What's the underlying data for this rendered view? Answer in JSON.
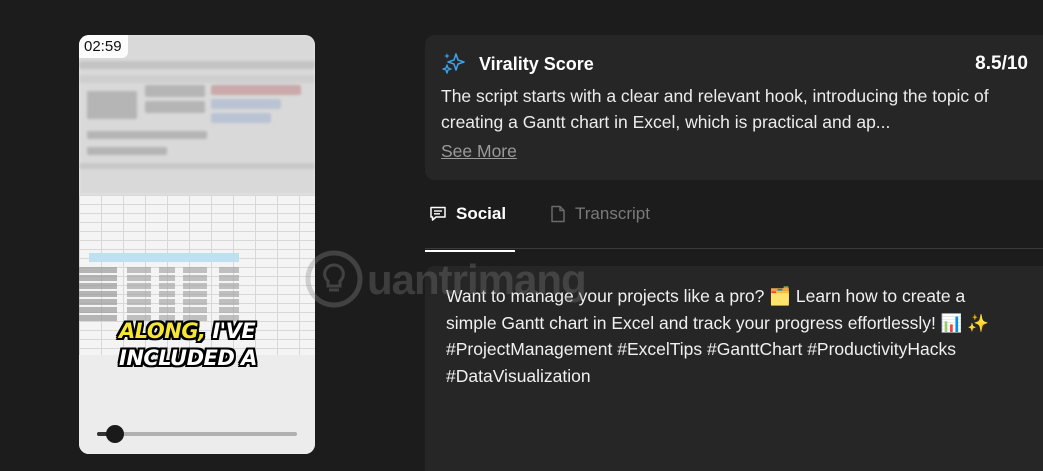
{
  "video": {
    "timestamp": "02:59",
    "caption_highlight": "ALONG,",
    "caption_rest_line1": " I'VE",
    "caption_line2": "INCLUDED A",
    "progress": 0.09,
    "caption_highlight_color": "#f5e633"
  },
  "score_card": {
    "icon": "sparkle-icon",
    "title": "Virality Score",
    "value": "8.5/10",
    "description": "The script starts with a clear and relevant hook, introducing the topic of creating a Gantt chart in Excel, which is practical and ap...",
    "see_more": "See More"
  },
  "tabs": [
    {
      "label": "Social",
      "icon": "chat-icon",
      "active": true
    },
    {
      "label": "Transcript",
      "icon": "document-icon",
      "active": false
    }
  ],
  "social": {
    "text": "Want to manage your projects like a pro? 🗂️ Learn how to create a simple Gantt chart in Excel and track your progress effortlessly! 📊 ✨ #ProjectManagement #ExcelTips #GanttChart #ProductivityHacks #DataVisualization"
  },
  "watermark": {
    "text": "uantrimang"
  },
  "colors": {
    "background": "#1c1c1c",
    "card": "#262626",
    "accent_sparkle": "#3aa0e8"
  }
}
